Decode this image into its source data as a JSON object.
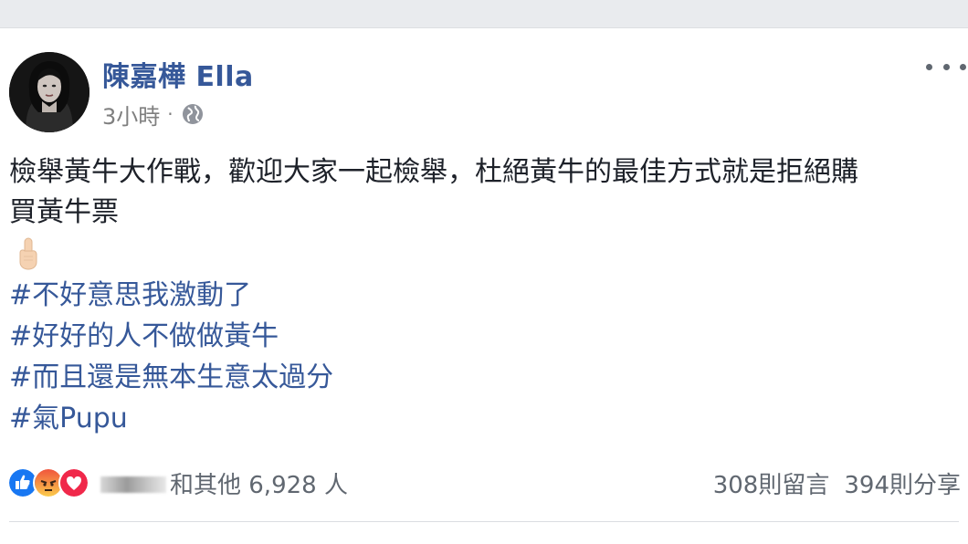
{
  "post": {
    "author": "陳嘉樺 Ella",
    "timestamp": "3小時",
    "separator": "·",
    "privacy_icon": "globe-icon",
    "text_lines": [
      "檢舉黃牛大作戰，歡迎大家一起檢舉，杜絕黃牛的最佳方式就是拒絕購",
      "買黃牛票"
    ],
    "emoji": "raised-index-finger-icon",
    "hashtags": [
      "#不好意思我激動了",
      "#好好的人不做做黃牛",
      "#而且還是無本生意太過分",
      "#氣Pupu"
    ]
  },
  "engagement": {
    "reaction_icons": [
      "like-icon",
      "angry-icon",
      "love-icon"
    ],
    "reaction_summary": "和其他 6,928 人",
    "comments": "308則留言",
    "shares": "394則分享"
  },
  "colors": {
    "link_blue": "#365899",
    "text": "#1d2129",
    "secondary": "#606770",
    "like_blue": "#1877f2",
    "angry_orange": "#f7714c",
    "love_red": "#f0284a"
  }
}
